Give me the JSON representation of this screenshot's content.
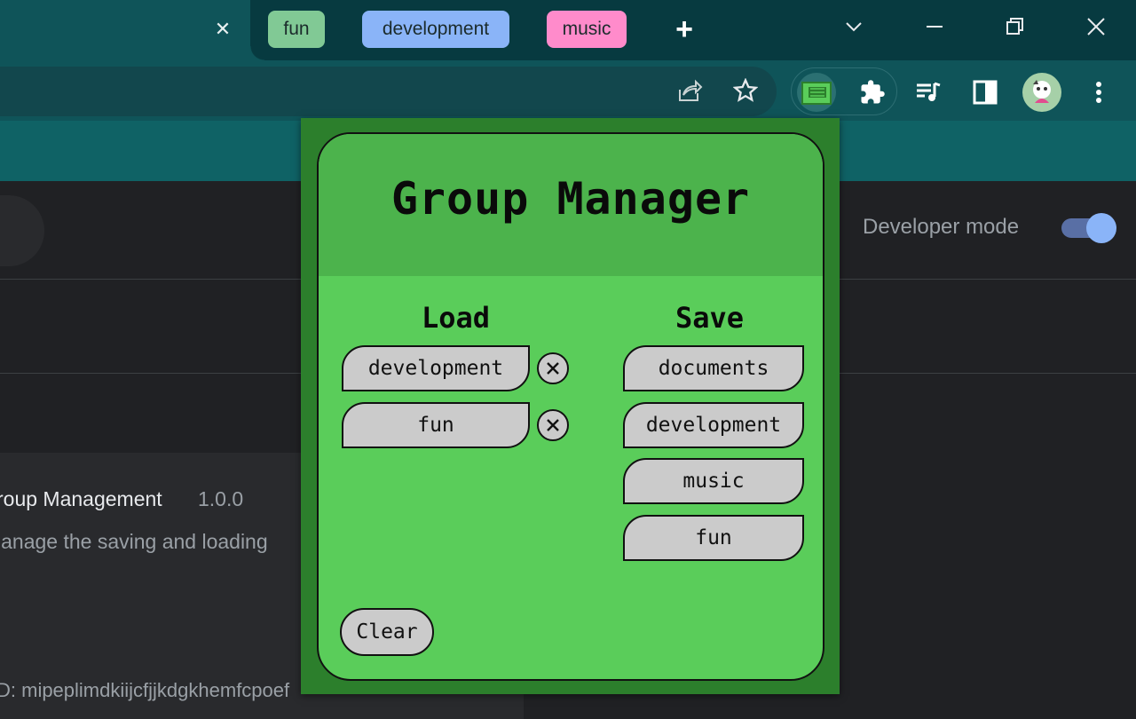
{
  "browser": {
    "tab_groups": [
      {
        "label": "fun",
        "color": "#81c995"
      },
      {
        "label": "development",
        "color": "#8ab4f8"
      },
      {
        "label": "music",
        "color": "#ff8bcb"
      }
    ],
    "icons": {
      "tab_close": "close-icon",
      "new_tab": "plus-icon",
      "tab_search": "chevron-down-icon",
      "minimize": "minimize-icon",
      "restore": "restore-icon",
      "close_window": "close-icon",
      "share": "share-icon",
      "bookmark": "star-icon",
      "extension_active": "group-manager-extension-icon",
      "extensions": "puzzle-icon",
      "media": "media-queue-icon",
      "side_panel": "side-panel-icon",
      "profile": "avatar",
      "menu": "kebab-menu-icon"
    }
  },
  "extensions_page": {
    "developer_mode_label": "Developer mode",
    "developer_mode_on": true,
    "extension_name": "roup Management",
    "extension_version": "1.0.0",
    "extension_description": "lanage the saving and loading",
    "extension_id": "D: mipeplimdkiijcfjjkdgkhemfcpoef"
  },
  "popup": {
    "title": "Group Manager",
    "load_title": "Load",
    "save_title": "Save",
    "load_items": [
      "development",
      "fun"
    ],
    "save_items": [
      "documents",
      "development",
      "music",
      "fun"
    ],
    "clear_label": "Clear",
    "colors": {
      "frame": "#2c7f2c",
      "body": "#5acd5a",
      "header": "#4cb34c",
      "button": "#cbcbcb"
    }
  }
}
